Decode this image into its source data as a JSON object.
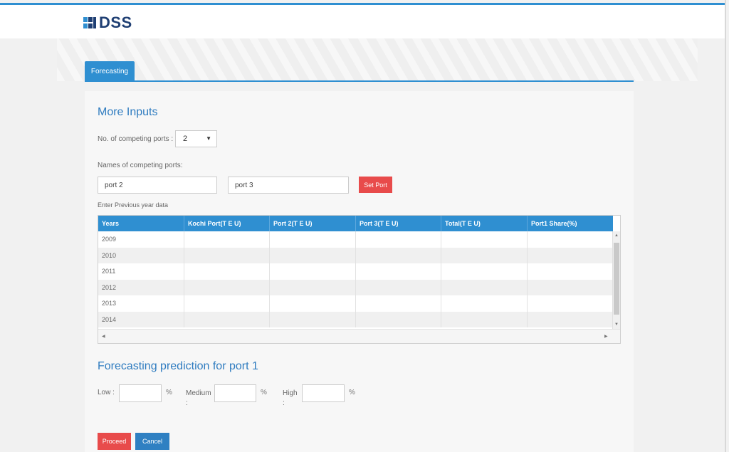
{
  "brand": {
    "name": "DSS"
  },
  "tabs": [
    {
      "label": "Forecasting"
    }
  ],
  "more_inputs": {
    "title": "More Inputs",
    "competing_ports_label": "No. of competing ports :",
    "competing_ports_value": "2",
    "names_label": "Names of competing ports:",
    "port_names": [
      "port 2",
      "port 3"
    ],
    "set_port_label": "Set Port",
    "prev_year_label": "Enter Previous year data"
  },
  "table": {
    "columns": [
      "Years",
      "Kochi Port(T E U)",
      "Port 2(T E U)",
      "Port 3(T E U)",
      "Total(T E U)",
      "Port1 Share(%)"
    ],
    "rows": [
      [
        "2009",
        "",
        "",
        "",
        "",
        ""
      ],
      [
        "2010",
        "",
        "",
        "",
        "",
        ""
      ],
      [
        "2011",
        "",
        "",
        "",
        "",
        ""
      ],
      [
        "2012",
        "",
        "",
        "",
        "",
        ""
      ],
      [
        "2013",
        "",
        "",
        "",
        "",
        ""
      ],
      [
        "2014",
        "",
        "",
        "",
        "",
        ""
      ]
    ]
  },
  "forecast": {
    "title": "Forecasting prediction for port 1",
    "low_label": "Low :",
    "medium_label": "Medium :",
    "high_label": "High :",
    "low_value": "",
    "medium_value": "",
    "high_value": "",
    "percent_sign": "%"
  },
  "actions": {
    "proceed_label": "Proceed",
    "cancel_label": "Cancel"
  },
  "colors": {
    "accent": "#2f8fd1",
    "danger": "#e84b4b",
    "brand": "#1f3f73"
  }
}
